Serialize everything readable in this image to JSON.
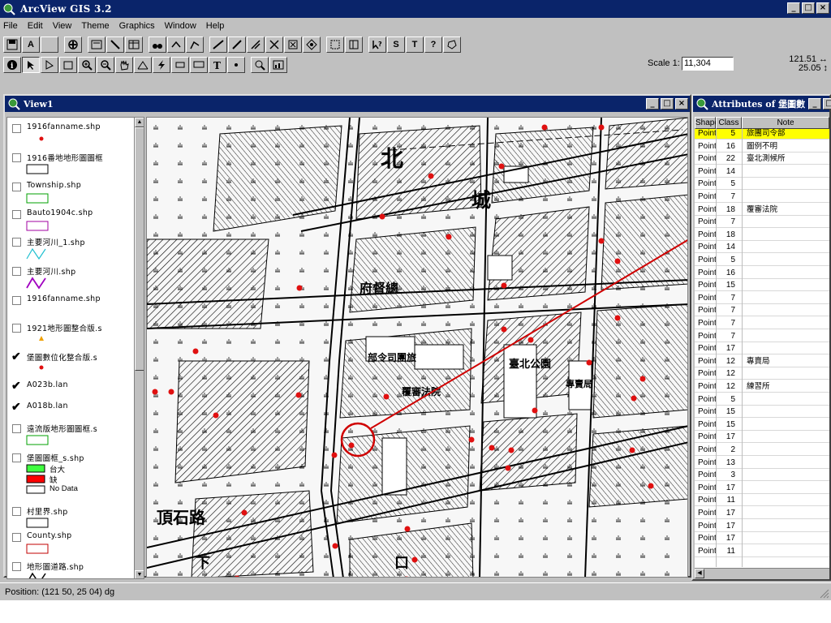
{
  "app": {
    "title": "ArcView GIS 3.2"
  },
  "menu": [
    "File",
    "Edit",
    "View",
    "Theme",
    "Graphics",
    "Window",
    "Help"
  ],
  "toolbar": {
    "text_tool_label": "A",
    "help_label": "?",
    "text_label": "T",
    "select_label": "S"
  },
  "scale": {
    "label": "Scale 1:",
    "value": "11,304"
  },
  "coords": {
    "x": "121.51 ↔",
    "y": "25.05 ↕"
  },
  "view": {
    "title": "View1",
    "toc": [
      {
        "label": "1916fanname.shp",
        "checked": false,
        "symbol": "red-dot"
      },
      {
        "label": "1916番地地形圖圖框",
        "checked": false,
        "symbol": "black-rect"
      },
      {
        "label": "Township.shp",
        "checked": false,
        "symbol": "green-rect"
      },
      {
        "label": "Bauto1904c.shp",
        "checked": false,
        "symbol": "purple-rect"
      },
      {
        "label": "主要河川_1.shp",
        "checked": false,
        "symbol": "cyan-line"
      },
      {
        "label": "主要河川.shp",
        "checked": false,
        "symbol": "purple-line"
      },
      {
        "label": "1916fanname.shp",
        "checked": false,
        "symbol": "none"
      },
      {
        "label": "1921地形圖整合版.s",
        "checked": false,
        "symbol": "orange-dot"
      },
      {
        "label": "堡圖數位化整合版.s",
        "checked": true,
        "symbol": "red-dot"
      },
      {
        "label": "A023b.lan",
        "checked": true,
        "symbol": "none"
      },
      {
        "label": "A018b.lan",
        "checked": true,
        "symbol": "none"
      },
      {
        "label": "遠流版地形圖圖框.s",
        "checked": false,
        "symbol": "green-rect"
      },
      {
        "label": "堡圖圖框_s.shp",
        "checked": false,
        "symbol": "legend-multi",
        "sub": [
          "台大",
          "缺",
          "No Data"
        ]
      },
      {
        "label": "村里界.shp",
        "checked": false,
        "symbol": "black-rect"
      },
      {
        "label": "County.shp",
        "checked": false,
        "symbol": "red-rect"
      },
      {
        "label": "地形圖道路.shp",
        "checked": false,
        "symbol": "black-line"
      }
    ]
  },
  "map": {
    "labels": [
      "北",
      "城",
      "府督總",
      "部令司團旅",
      "臺北公園",
      "覆審法院",
      "專賣局",
      "頂石路",
      "下",
      "口"
    ]
  },
  "attributes": {
    "title": "Attributes of 堡圖數",
    "columns": [
      "Shape",
      "Class",
      "Note"
    ],
    "rows": [
      {
        "shape": "Point",
        "class": "5",
        "note": "旅團司令部",
        "selected": true
      },
      {
        "shape": "Point",
        "class": "16",
        "note": "圖例不明"
      },
      {
        "shape": "Point",
        "class": "22",
        "note": "臺北測候所"
      },
      {
        "shape": "Point",
        "class": "14",
        "note": ""
      },
      {
        "shape": "Point",
        "class": "5",
        "note": ""
      },
      {
        "shape": "Point",
        "class": "7",
        "note": ""
      },
      {
        "shape": "Point",
        "class": "18",
        "note": "覆審法院"
      },
      {
        "shape": "Point",
        "class": "7",
        "note": ""
      },
      {
        "shape": "Point",
        "class": "18",
        "note": ""
      },
      {
        "shape": "Point",
        "class": "14",
        "note": ""
      },
      {
        "shape": "Point",
        "class": "5",
        "note": ""
      },
      {
        "shape": "Point",
        "class": "16",
        "note": ""
      },
      {
        "shape": "Point",
        "class": "15",
        "note": ""
      },
      {
        "shape": "Point",
        "class": "7",
        "note": ""
      },
      {
        "shape": "Point",
        "class": "7",
        "note": ""
      },
      {
        "shape": "Point",
        "class": "7",
        "note": ""
      },
      {
        "shape": "Point",
        "class": "7",
        "note": ""
      },
      {
        "shape": "Point",
        "class": "17",
        "note": ""
      },
      {
        "shape": "Point",
        "class": "12",
        "note": "專賣局"
      },
      {
        "shape": "Point",
        "class": "12",
        "note": ""
      },
      {
        "shape": "Point",
        "class": "12",
        "note": "練習所"
      },
      {
        "shape": "Point",
        "class": "5",
        "note": ""
      },
      {
        "shape": "Point",
        "class": "15",
        "note": ""
      },
      {
        "shape": "Point",
        "class": "15",
        "note": ""
      },
      {
        "shape": "Point",
        "class": "17",
        "note": ""
      },
      {
        "shape": "Point",
        "class": "2",
        "note": ""
      },
      {
        "shape": "Point",
        "class": "13",
        "note": ""
      },
      {
        "shape": "Point",
        "class": "3",
        "note": ""
      },
      {
        "shape": "Point",
        "class": "17",
        "note": ""
      },
      {
        "shape": "Point",
        "class": "11",
        "note": ""
      },
      {
        "shape": "Point",
        "class": "17",
        "note": ""
      },
      {
        "shape": "Point",
        "class": "17",
        "note": ""
      },
      {
        "shape": "Point",
        "class": "17",
        "note": ""
      },
      {
        "shape": "Point",
        "class": "11",
        "note": ""
      }
    ]
  },
  "status": {
    "text": "Position: (121 50, 25 04) dg"
  },
  "colors": {
    "titlebar": "#0a246a",
    "selection": "#ffff00",
    "point": "#e01010",
    "highlight": "#d00000"
  }
}
